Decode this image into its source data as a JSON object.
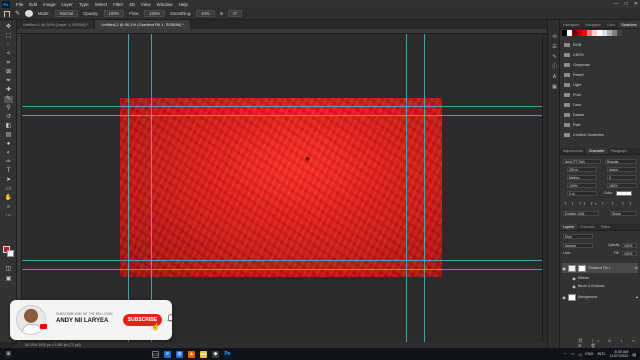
{
  "menubar": {
    "logo": "Ps",
    "items": [
      "File",
      "Edit",
      "Image",
      "Layer",
      "Type",
      "Select",
      "Filter",
      "3D",
      "View",
      "Window",
      "Help"
    ],
    "controls": [
      "—",
      "□",
      "✕"
    ]
  },
  "options": {
    "mode_label": "Mode:",
    "mode_value": "Normal",
    "opacity_label": "Opacity:",
    "opacity_value": "100%",
    "flow_label": "Flow:",
    "flow_value": "100%",
    "smoothing_label": "Smoothing:",
    "smoothing_value": "10%",
    "size_value": "0°"
  },
  "tabs": [
    {
      "label": "Untitled-1 @ 50% (Layer 1, RGB/8) *",
      "active": false
    },
    {
      "label": "Untitled-2 @ 50.1% (Gradient Fill 1, RGB/8#) *",
      "active": true
    }
  ],
  "status": {
    "text": "50.15%   1920 px x 1080 px (72 ppi)"
  },
  "panels": {
    "swatch_tabs": [
      "Histogram",
      "Navigator",
      "Color",
      "Swatches"
    ],
    "swatch_colors": [
      "#000000",
      "#ffffff",
      "#7a0000",
      "#c00000",
      "#ff0000",
      "#ff7f7f",
      "#ffcccc",
      "#ffffff",
      "#e0e0e0",
      "#b0b0b0",
      "#808080",
      "#404040"
    ],
    "folders": [
      "RGB",
      "CMYK",
      "Grayscale",
      "Pastel",
      "Light",
      "Pure",
      "Dark",
      "Darker",
      "Pale",
      "Content Swatches"
    ],
    "char_tabs": [
      "Adjustments",
      "Character",
      "Paragraph"
    ],
    "character": {
      "font": "Arial (TT Std)",
      "style": "Regular",
      "size": "200 pt",
      "leading": "(Auto)",
      "kerning": "Metrics",
      "tracking": "0",
      "vscale": "100%",
      "hscale": "100%",
      "baseline": "0 pt",
      "color_label": "Color:",
      "language": "English: USA",
      "aa": "Sharp"
    },
    "layer_tabs": [
      "Layers",
      "Channels",
      "Paths"
    ],
    "layers_toolbar": {
      "kind": "Kind",
      "blend": "Normal",
      "opacity_label": "Opacity:",
      "opacity_value": "100%",
      "fill_label": "Fill:",
      "fill_value": "100%",
      "lock_label": "Lock:"
    },
    "layers": [
      {
        "name": "Gradient Fill 1",
        "selected": true,
        "fx": "fx"
      },
      {
        "name": "Effects",
        "selected": false
      },
      {
        "name": "Bevel & Emboss",
        "selected": false
      },
      {
        "name": "Background",
        "selected": false
      }
    ]
  },
  "overlay": {
    "subtitle": "SUBSCRIBE AND HIT THE BELL ICON",
    "name": "ANDY NII LARYEA",
    "button": "SUBSCRIBE"
  },
  "taskbar": {
    "tray_lang": "ENG",
    "tray_region": "INTL",
    "time": "8:30 AM",
    "date": "11/27/2022"
  }
}
